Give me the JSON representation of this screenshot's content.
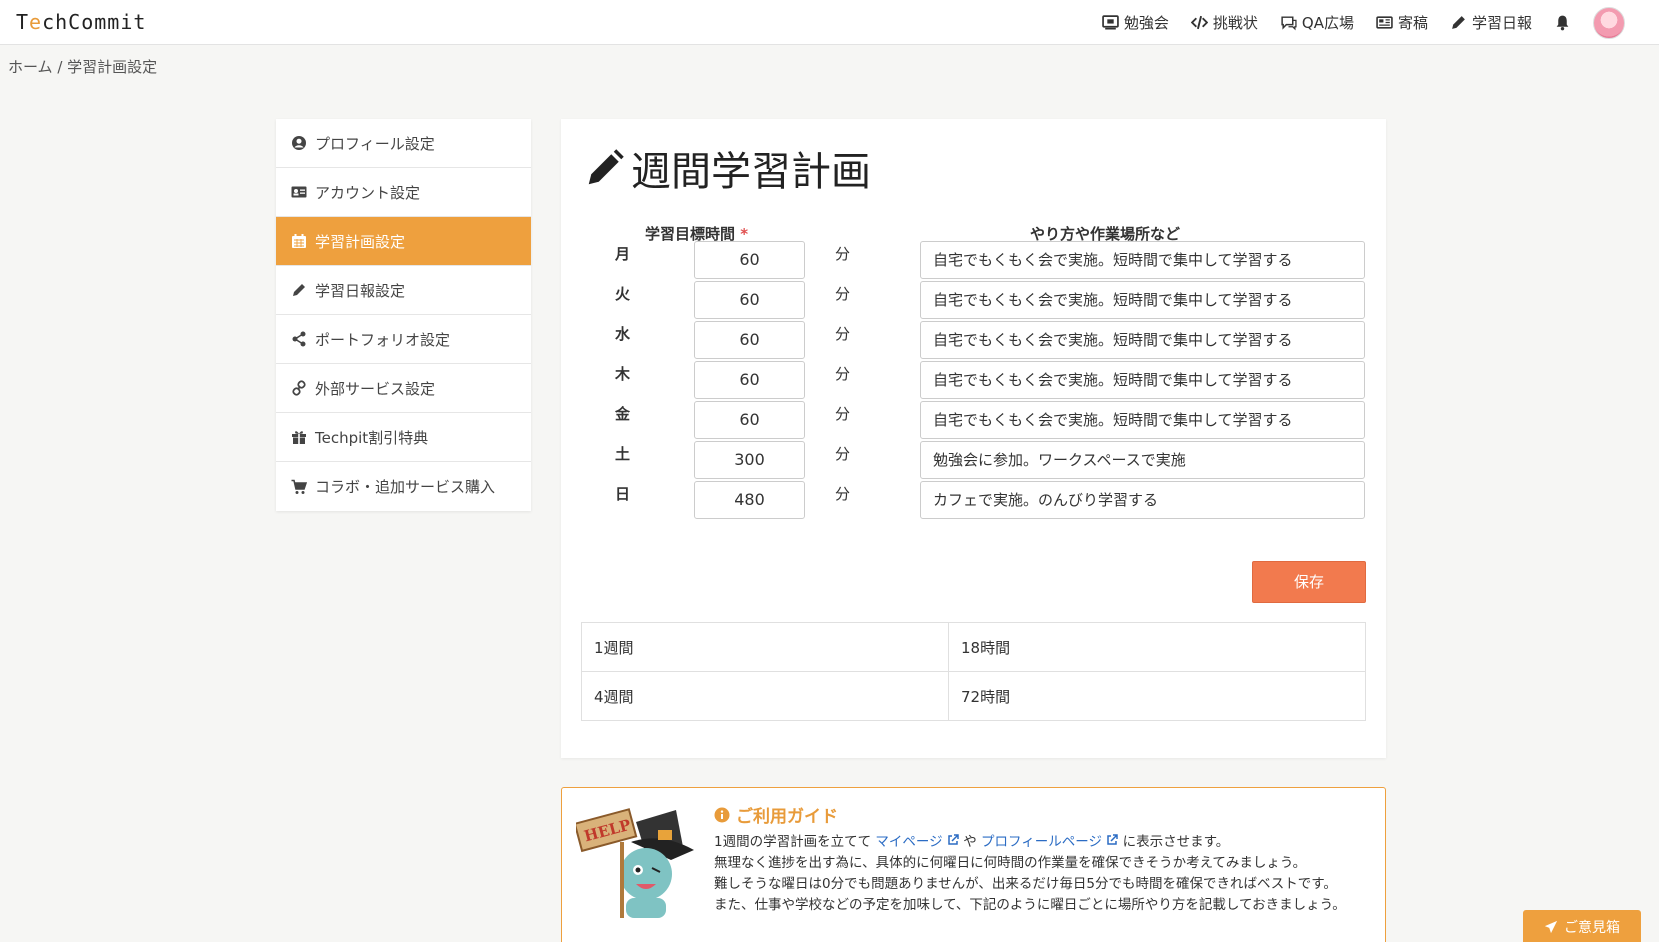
{
  "header": {
    "logo": "TechCommit",
    "nav": [
      {
        "label": "勉強会",
        "icon": "monitor-icon"
      },
      {
        "label": "挑戦状",
        "icon": "code-icon"
      },
      {
        "label": "QA広場",
        "icon": "chat-icon"
      },
      {
        "label": "寄稿",
        "icon": "newspaper-icon"
      },
      {
        "label": "学習日報",
        "icon": "pencil-icon"
      }
    ]
  },
  "breadcrumb": "ホーム / 学習計画設定",
  "sidebar": {
    "items": [
      {
        "label": "プロフィール設定",
        "icon": "user-circle-icon"
      },
      {
        "label": "アカウント設定",
        "icon": "id-card-icon"
      },
      {
        "label": "学習計画設定",
        "icon": "calendar-icon",
        "active": true
      },
      {
        "label": "学習日報設定",
        "icon": "pencil-icon"
      },
      {
        "label": "ポートフォリオ設定",
        "icon": "share-icon"
      },
      {
        "label": "外部サービス設定",
        "icon": "link-icon"
      },
      {
        "label": "Techpit割引特典",
        "icon": "gift-icon"
      },
      {
        "label": "コラボ・追加サービス購入",
        "icon": "cart-icon"
      }
    ]
  },
  "plan": {
    "title": "週間学習計画",
    "col_time": "学習目標時間",
    "required_mark": "*",
    "col_method": "やり方や作業場所など",
    "unit": "分",
    "rows": [
      {
        "day": "月",
        "minutes": "60",
        "method": "自宅でもくもく会で実施。短時間で集中して学習する"
      },
      {
        "day": "火",
        "minutes": "60",
        "method": "自宅でもくもく会で実施。短時間で集中して学習する"
      },
      {
        "day": "水",
        "minutes": "60",
        "method": "自宅でもくもく会で実施。短時間で集中して学習する"
      },
      {
        "day": "木",
        "minutes": "60",
        "method": "自宅でもくもく会で実施。短時間で集中して学習する"
      },
      {
        "day": "金",
        "minutes": "60",
        "method": "自宅でもくもく会で実施。短時間で集中して学習する"
      },
      {
        "day": "土",
        "minutes": "300",
        "method": "勉強会に参加。ワークスペースで実施"
      },
      {
        "day": "日",
        "minutes": "480",
        "method": "カフェで実施。のんびり学習する"
      }
    ],
    "save_label": "保存",
    "summary": [
      {
        "period": "1週間",
        "total": "18時間"
      },
      {
        "period": "4週間",
        "total": "72時間"
      }
    ]
  },
  "guide": {
    "title": "ご利用ガイド",
    "line1_a": "1週間の学習計画を立てて ",
    "link1": "マイページ",
    "line1_b": " や ",
    "link2": "プロフィールページ",
    "line1_c": " に表示させます。",
    "line2": "無理なく進捗を出す為に、具体的に何曜日に何時間の作業量を確保できそうか考えてみましょう。",
    "line3": "難しそうな曜日は0分でも問題ありませんが、出来るだけ毎日5分でも時間を確保できればベストです。",
    "line4": "また、仕事や学校などの予定を加味して、下記のように曜日ごとに場所やり方を記載しておきましょう。",
    "mascot_sign": "HELP"
  },
  "feedback_label": "ご意見箱",
  "colors": {
    "accent": "#eea03e",
    "save": "#f27a4e",
    "link": "#2b6cc4"
  }
}
